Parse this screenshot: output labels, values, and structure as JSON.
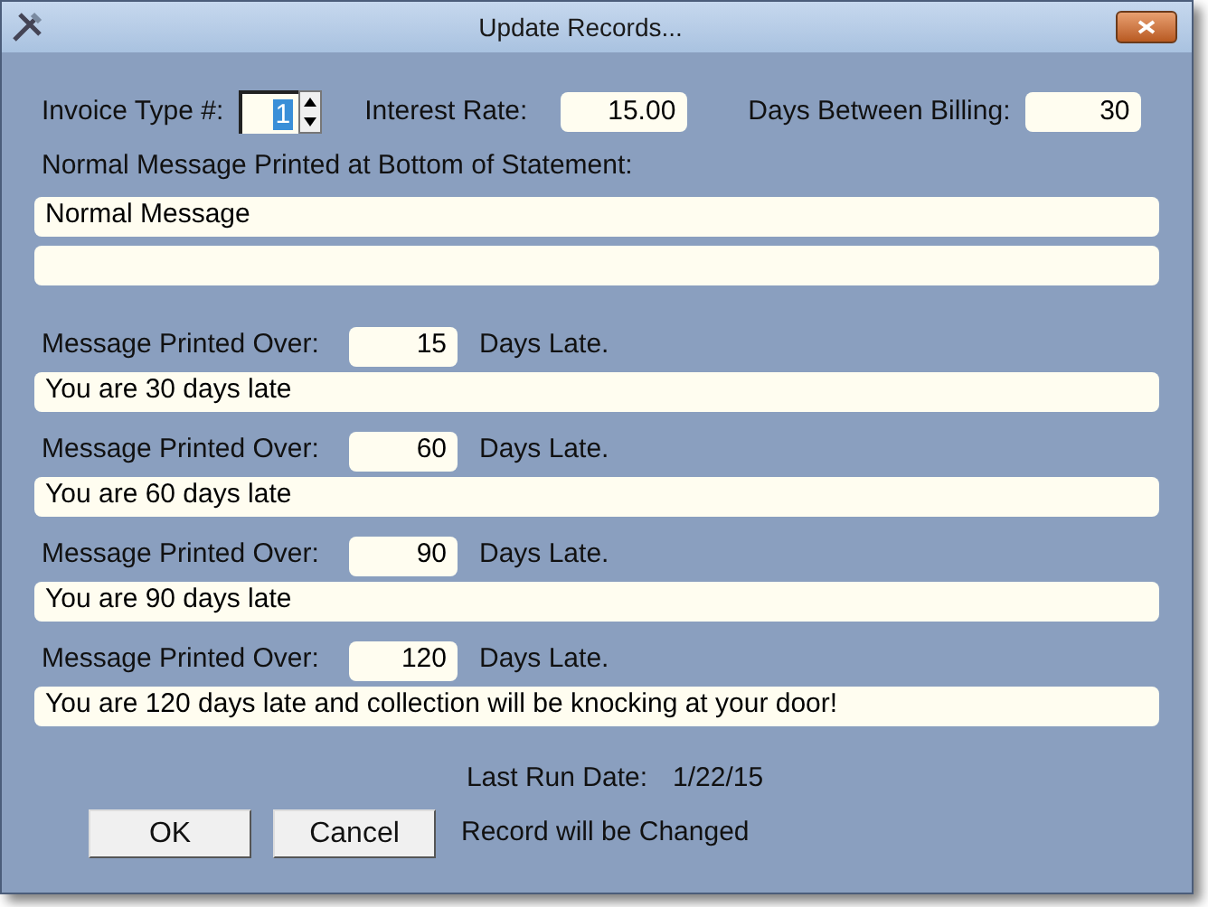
{
  "window": {
    "title": "Update Records..."
  },
  "invoice_type": {
    "label": "Invoice Type #:",
    "value": "1"
  },
  "interest_rate": {
    "label": "Interest Rate:",
    "value": "15.00"
  },
  "days_between_billing": {
    "label": "Days Between Billing:",
    "value": "30"
  },
  "normal_message": {
    "label": "Normal Message Printed at Bottom of Statement:",
    "lines": [
      {
        "kind": "filled",
        "value": "Normal Message"
      },
      {
        "kind": "blank"
      }
    ]
  },
  "late_messages": [
    {
      "label": "Message Printed Over:",
      "days": "15",
      "suffix": "Days Late.",
      "message": "You are 30 days late"
    },
    {
      "label": "Message Printed Over:",
      "days": "60",
      "suffix": "Days Late.",
      "message": "You are 60 days late"
    },
    {
      "label": "Message Printed Over:",
      "days": "90",
      "suffix": "Days Late.",
      "message": "You are 90 days late"
    },
    {
      "label": "Message Printed Over:",
      "days": "120",
      "suffix": "Days Late.",
      "message": "You are 120 days late and collection will be knocking at your door!"
    }
  ],
  "last_run": {
    "label": "Last Run Date:",
    "value": "1/22/15"
  },
  "buttons": [
    "OK",
    "Cancel"
  ],
  "status": "Record will be Changed"
}
